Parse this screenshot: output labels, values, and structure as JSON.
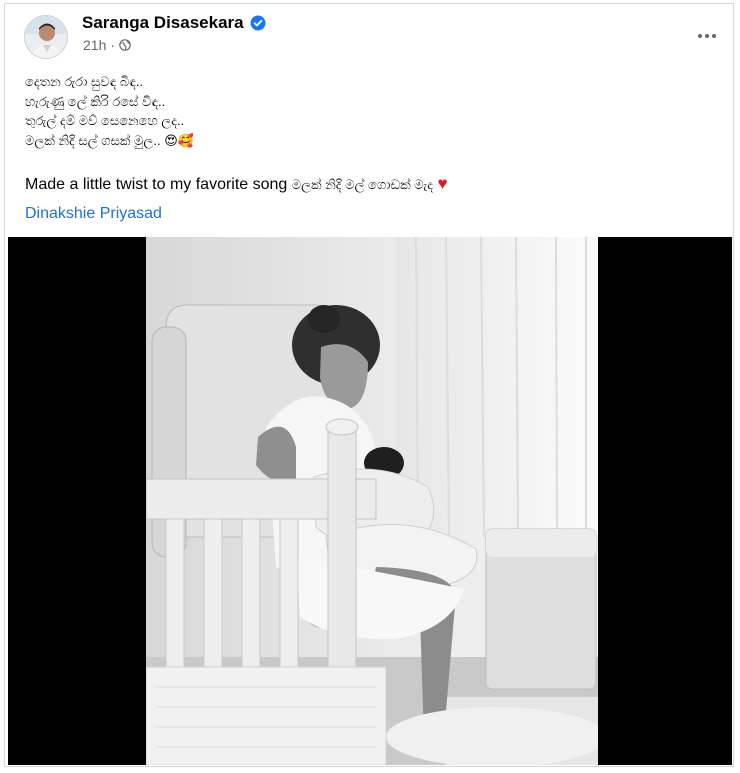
{
  "post": {
    "author": "Saranga Disasekara",
    "timestamp": "21h",
    "separator": "·",
    "visibility_icon": "globe-icon",
    "verified_icon": "verified-badge-icon",
    "more_icon": "more-options-icon"
  },
  "lyrics": [
    {
      "text": "දෙතන රුරා සුවඳ බිඳ..",
      "emoji": ""
    },
    {
      "text": "හැරුණු ලේ කිරි රසේ විඳ..",
      "emoji": ""
    },
    {
      "text": "තුරුල් දම් මව් සෙනෙහෙ ලද..",
      "emoji": ""
    },
    {
      "text": "මලක් නිදි සල් ගසක් මුල..",
      "emoji": "😍🥰"
    }
  ],
  "caption": {
    "text": "Made a little twist to my favorite song",
    "sinhala": "මලක් නිදි මල් ගොඩක් මැද",
    "emoji": "♥"
  },
  "mention": "Dinakshie Priyasad",
  "colors": {
    "link": "#216fdb",
    "meta": "#65676b",
    "verified": "#1877f2",
    "heart": "#e0162b"
  }
}
